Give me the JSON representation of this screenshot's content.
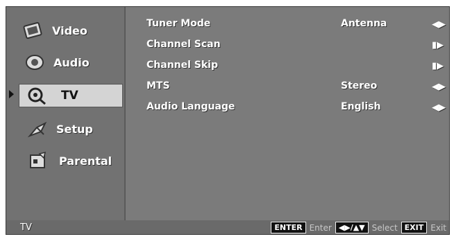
{
  "sidebar": {
    "items": [
      {
        "label": "Video",
        "icon": "video-icon"
      },
      {
        "label": "Audio",
        "icon": "audio-icon"
      },
      {
        "label": "TV",
        "icon": "tv-icon"
      },
      {
        "label": "Setup",
        "icon": "setup-icon"
      },
      {
        "label": "Parental",
        "icon": "parental-icon"
      }
    ],
    "selected_index": 2
  },
  "menu": {
    "rows": [
      {
        "label": "Tuner Mode",
        "value": "Antenna",
        "arrow": "◀▶"
      },
      {
        "label": "Channel Scan",
        "value": "",
        "arrow": "▮▶"
      },
      {
        "label": "Channel Skip",
        "value": "",
        "arrow": "▮▶"
      },
      {
        "label": "MTS",
        "value": "Stereo",
        "arrow": "◀▶"
      },
      {
        "label": "Audio Language",
        "value": "English",
        "arrow": "◀▶"
      }
    ]
  },
  "footer": {
    "title": "TV",
    "enter_key": "ENTER",
    "enter_label": "Enter",
    "nav_key": "◀▶/▲▼",
    "nav_label": "Select",
    "exit_key": "EXIT",
    "exit_label": "Exit"
  }
}
